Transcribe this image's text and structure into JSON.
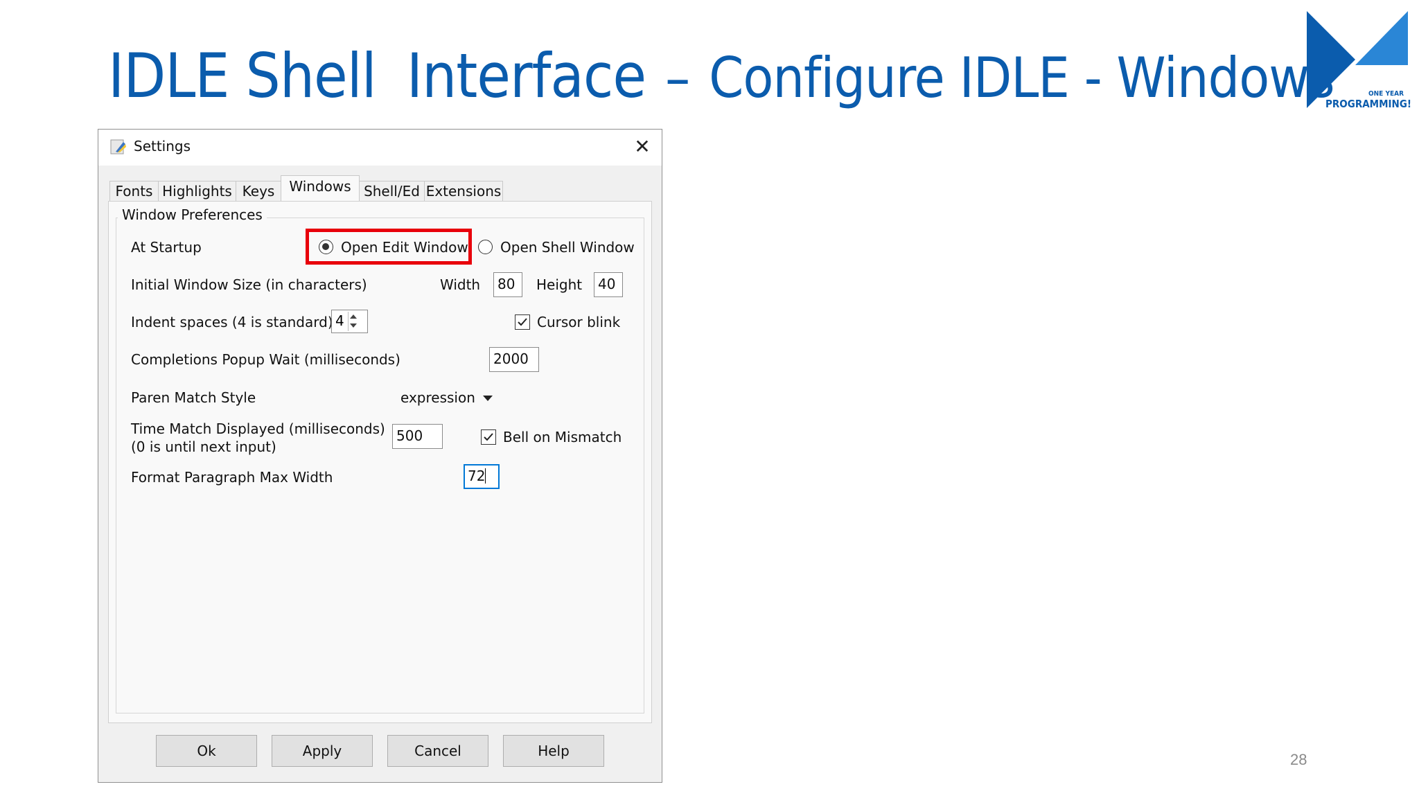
{
  "slide": {
    "title_part1": "IDLE Shell",
    "title_part2": "Interface",
    "title_dash": "–",
    "title_part3": "Configure IDLE - Windows",
    "page_number": "28",
    "logo_small_text": "ONE YEAR",
    "logo_big_text": "PROGRAMMING!",
    "accent_color": "#0b5cad"
  },
  "dialog": {
    "title": "Settings",
    "icons": {
      "app": "python-feather-icon",
      "close": "close-icon"
    },
    "tabs": [
      {
        "label": "Fonts",
        "active": false
      },
      {
        "label": "Highlights",
        "active": false
      },
      {
        "label": "Keys",
        "active": false
      },
      {
        "label": "Windows",
        "active": true
      },
      {
        "label": "Shell/Ed",
        "active": false
      },
      {
        "label": "Extensions",
        "active": false
      }
    ],
    "group_label": "Window Preferences",
    "at_startup": {
      "label": "At Startup",
      "option_edit": "Open Edit Window",
      "option_shell": "Open Shell Window",
      "selected": "Open Edit Window",
      "highlight_color": "#e8000b"
    },
    "window_size": {
      "label": "Initial Window Size  (in characters)",
      "width_label": "Width",
      "width_value": "80",
      "height_label": "Height",
      "height_value": "40"
    },
    "indent": {
      "label": "Indent spaces (4 is standard)",
      "value": "4"
    },
    "cursor_blink": {
      "label": "Cursor blink",
      "checked": true
    },
    "completions": {
      "label": "Completions Popup Wait (milliseconds)",
      "value": "2000"
    },
    "paren_style": {
      "label": "Paren Match Style",
      "value": "expression"
    },
    "time_match": {
      "label_line1": "Time Match Displayed (milliseconds)",
      "label_line2": "(0 is until next input)",
      "value": "500"
    },
    "bell": {
      "label": "Bell on Mismatch",
      "checked": true
    },
    "format_width": {
      "label": "Format Paragraph Max Width",
      "value": "72"
    },
    "buttons": {
      "ok": "Ok",
      "apply": "Apply",
      "cancel": "Cancel",
      "help": "Help"
    }
  }
}
